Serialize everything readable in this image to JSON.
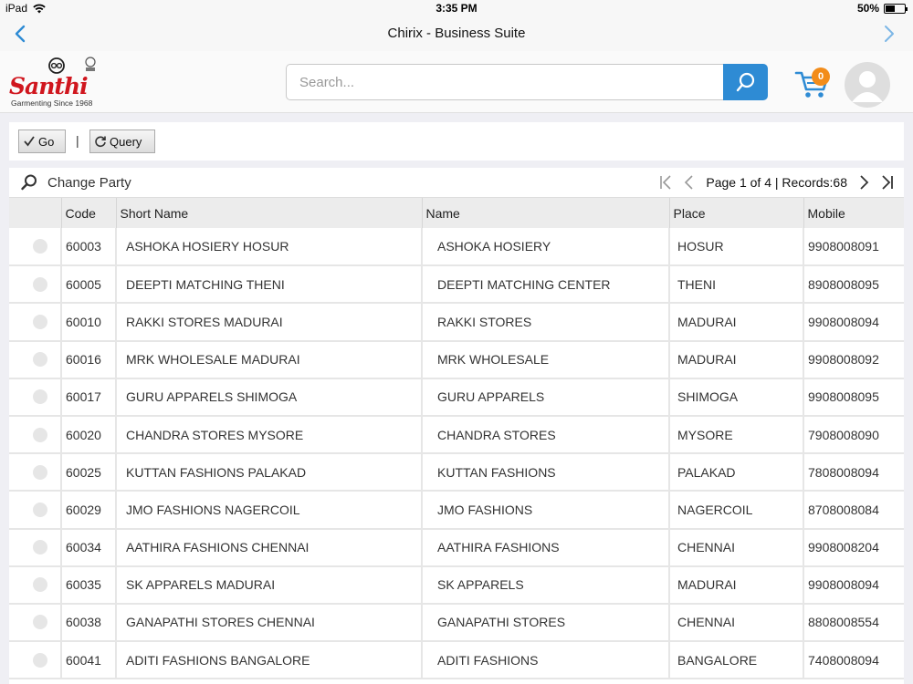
{
  "status_bar": {
    "device": "iPad",
    "time": "3:35 PM",
    "battery": "50%",
    "battery_level": 0.5
  },
  "nav": {
    "title": "Chirix - Business Suite"
  },
  "brand": {
    "logo_text": "Santhi",
    "tagline": "Garmenting Since 1968",
    "accent": "#d0161e"
  },
  "search": {
    "placeholder": "Search...",
    "value": ""
  },
  "cart": {
    "count": "0"
  },
  "toolbar": {
    "go_label": "Go",
    "separator": "|",
    "query_label": "Query"
  },
  "grid": {
    "change_party_label": "Change Party",
    "pager_text": "Page 1 of 4 | Records:68",
    "columns": {
      "code": "Code",
      "short_name": "Short Name",
      "name": "Name",
      "place": "Place",
      "mobile": "Mobile"
    },
    "rows": [
      {
        "code": "60003",
        "short_name": "ASHOKA HOSIERY HOSUR",
        "name": "ASHOKA HOSIERY",
        "place": "HOSUR",
        "mobile": "9908008091"
      },
      {
        "code": "60005",
        "short_name": "DEEPTI MATCHING THENI",
        "name": "DEEPTI MATCHING CENTER",
        "place": "THENI",
        "mobile": "8908008095"
      },
      {
        "code": "60010",
        "short_name": "RAKKI STORES MADURAI",
        "name": "RAKKI STORES",
        "place": "MADURAI",
        "mobile": "9908008094"
      },
      {
        "code": "60016",
        "short_name": "MRK WHOLESALE MADURAI",
        "name": "MRK WHOLESALE",
        "place": "MADURAI",
        "mobile": "9908008092"
      },
      {
        "code": "60017",
        "short_name": "GURU APPARELS SHIMOGA",
        "name": "GURU APPARELS",
        "place": "SHIMOGA",
        "mobile": "9908008095"
      },
      {
        "code": "60020",
        "short_name": "CHANDRA STORES MYSORE",
        "name": "CHANDRA STORES",
        "place": "MYSORE",
        "mobile": "7908008090"
      },
      {
        "code": "60025",
        "short_name": "KUTTAN FASHIONS PALAKAD",
        "name": "KUTTAN FASHIONS",
        "place": "PALAKAD",
        "mobile": "7808008094"
      },
      {
        "code": "60029",
        "short_name": "JMO FASHIONS NAGERCOIL",
        "name": "JMO FASHIONS",
        "place": "NAGERCOIL",
        "mobile": "8708008084"
      },
      {
        "code": "60034",
        "short_name": "AATHIRA FASHIONS CHENNAI",
        "name": "AATHIRA FASHIONS",
        "place": "CHENNAI",
        "mobile": "9908008204"
      },
      {
        "code": "60035",
        "short_name": "SK APPARELS MADURAI",
        "name": "SK APPARELS",
        "place": "MADURAI",
        "mobile": "9908008094"
      },
      {
        "code": "60038",
        "short_name": "GANAPATHI STORES CHENNAI",
        "name": "GANAPATHI STORES",
        "place": "CHENNAI",
        "mobile": "8808008554"
      },
      {
        "code": "60041",
        "short_name": "ADITI FASHIONS BANGALORE",
        "name": "ADITI FASHIONS",
        "place": "BANGALORE",
        "mobile": "7408008094"
      }
    ]
  },
  "colors": {
    "nav_icon": "#2e8bd4",
    "search_button": "#2e8bd4",
    "cart_badge": "#f28c1a"
  }
}
